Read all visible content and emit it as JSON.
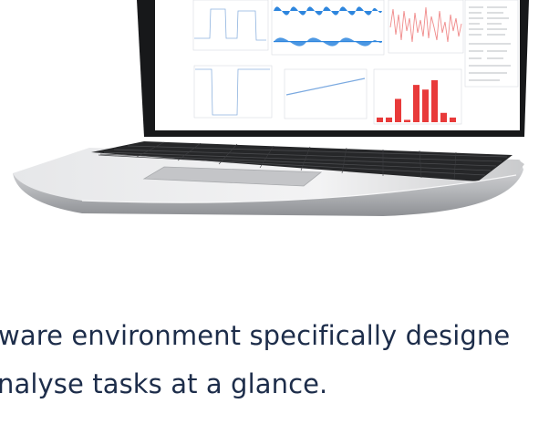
{
  "caption": {
    "line1": "ware environment specifically designe",
    "line2": "nalyse tasks at a glance."
  },
  "colors": {
    "text": "#1d2d4a",
    "wave_blue": "#2e86de",
    "bar_red": "#e83a3a",
    "noise_red": "#f08a8a",
    "line_blue": "#7aa9e0"
  },
  "screen": {
    "bar_chart": {
      "type": "bar",
      "values": [
        1,
        1,
        5,
        0.5,
        8,
        7,
        9,
        2,
        1
      ]
    }
  }
}
